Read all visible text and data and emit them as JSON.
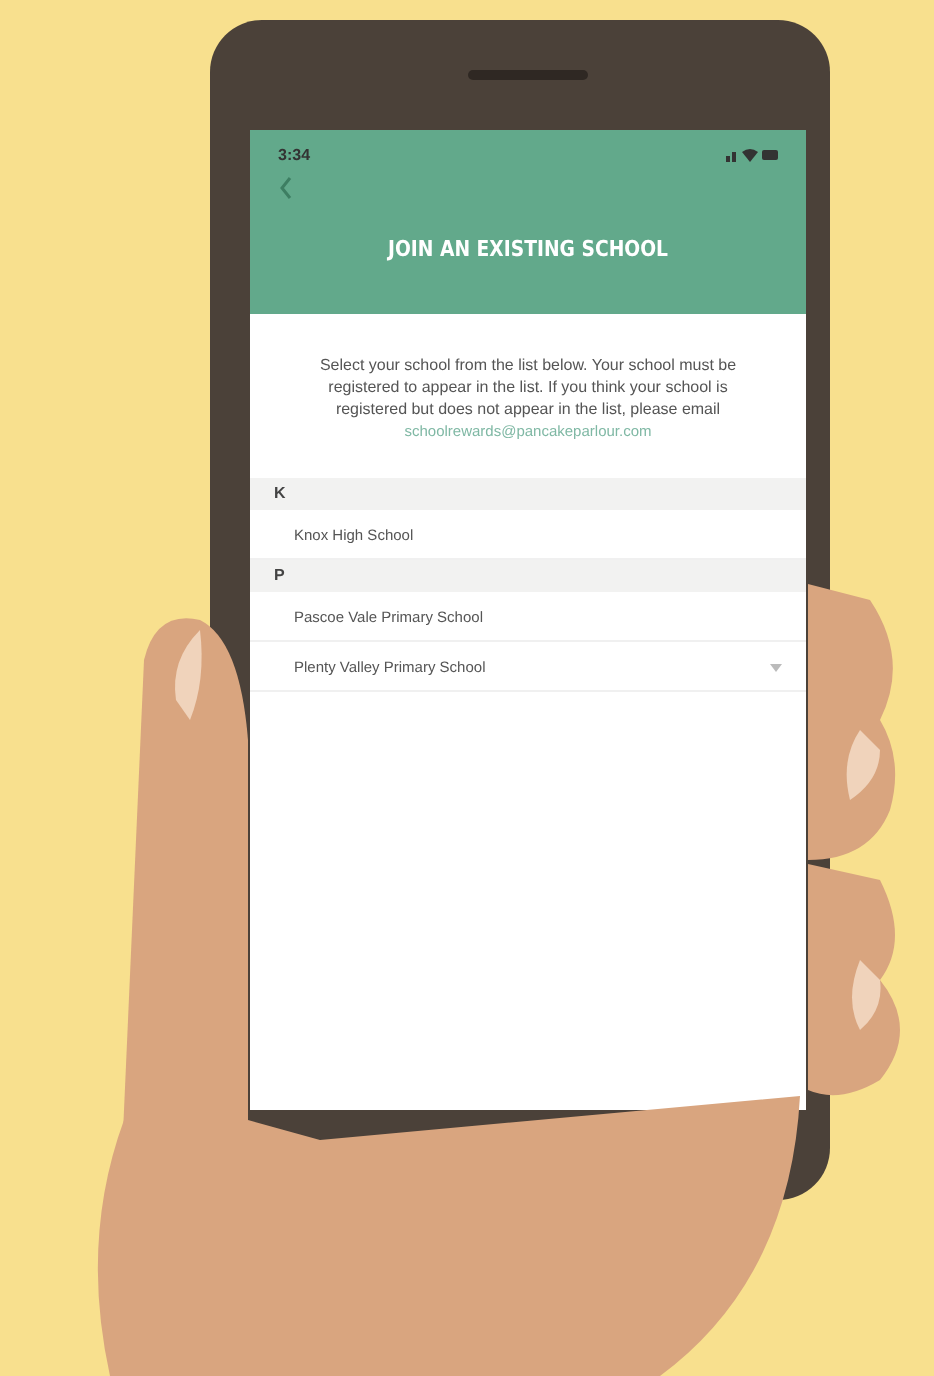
{
  "status_bar": {
    "time": "3:34"
  },
  "header": {
    "title": "JOIN AN EXISTING SCHOOL"
  },
  "intro": {
    "text": "Select your school from the list below. Your school must be registered to appear in the list. If you think your school is registered but does not appear in the list, please email",
    "email": "schoolrewards@pancakeparlour.com"
  },
  "sections": [
    {
      "letter": "K",
      "schools": [
        "Knox High School"
      ]
    },
    {
      "letter": "P",
      "schools": [
        "Pascoe Vale Primary School",
        "Plenty Valley Primary School"
      ]
    }
  ]
}
